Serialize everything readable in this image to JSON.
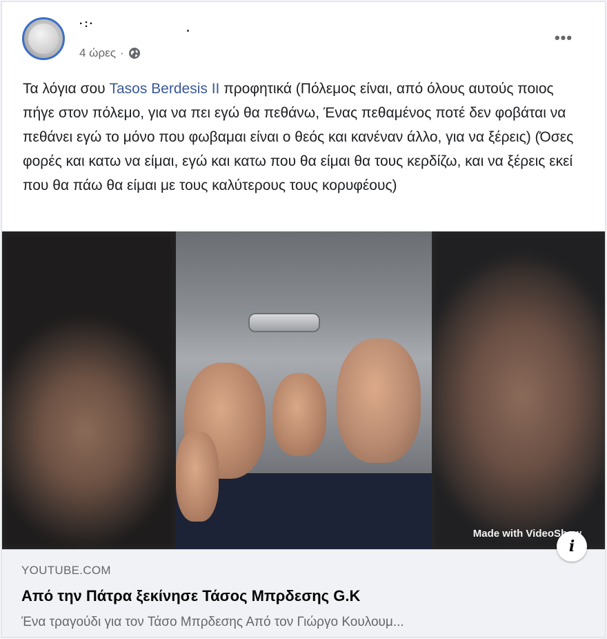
{
  "post": {
    "author_name": "·:·",
    "timestamp": "4 ώρες",
    "separator": "·",
    "privacy_icon": "globe-icon",
    "more_icon": "more-horizontal-icon",
    "more_label": "•••"
  },
  "body": {
    "text_before": "Τα λόγια σου ",
    "mention": "Tasos Berdesis II",
    "text_after": " προφητικά (Πόλεμος είναι, από όλους αυτούς ποιος πήγε στον πόλεμο, για να πει εγώ θα πεθάνω, Ένας πεθαμένος ποτέ δεν φοβάται να πεθάνει εγώ το μόνο που φωβαμαι είναι ο θεός και κανέναν άλλο, για να ξέρεις) (Όσες φορές και κατω να είμαι, εγώ και κατω που θα είμαι θα τους κερδίζω, και να ξέρεις εκεί που θα πάω θα είμαι με τους καλύτερους τους κορυφέους)"
  },
  "media": {
    "watermark": "Made with VideoShow",
    "info_icon": "info-icon",
    "info_label": "i"
  },
  "link_preview": {
    "domain": "YOUTUBE.COM",
    "title": "Από την Πάτρα ξεκίνησε Τάσος Μπρδεσης G.K",
    "description": "Ένα τραγούδι για τον Τάσο Μπρδεσης Από τον Γιώργο Κουλουμ..."
  },
  "colors": {
    "mention": "#385898",
    "avatar_ring": "#3b6fc9",
    "preview_bg": "#f0f2f5"
  }
}
